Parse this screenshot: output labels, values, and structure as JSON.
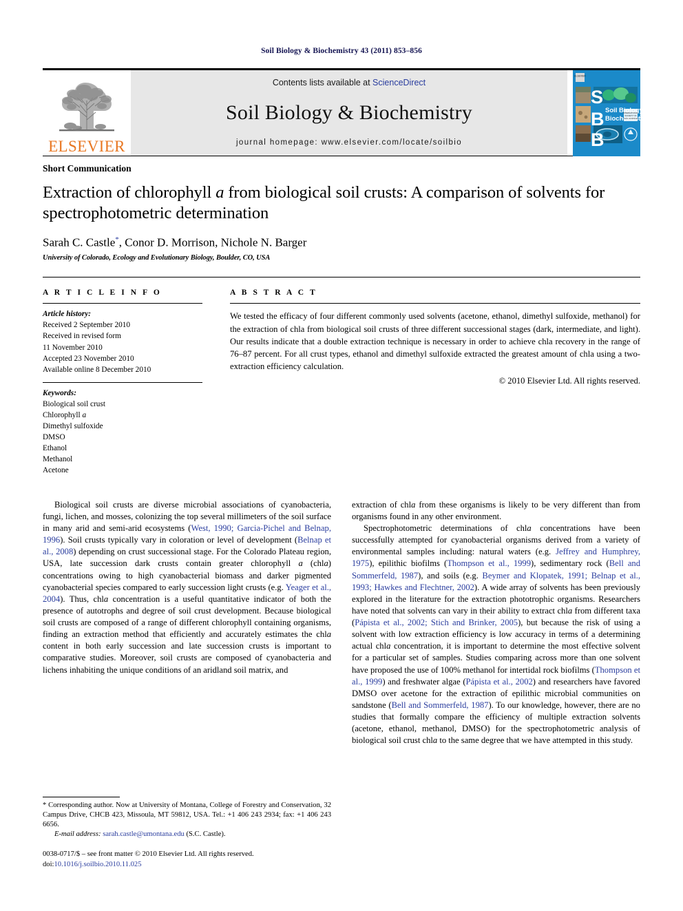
{
  "running_head": "Soil Biology & Biochemistry 43 (2011) 853–856",
  "masthead": {
    "publisher_wordmark": "ELSEVIER",
    "contents_prefix": "Contents lists available at ",
    "contents_link": "ScienceDirect",
    "journal_name": "Soil Biology & Biochemistry",
    "homepage_label": "journal homepage: www.elsevier.com/locate/soilbio",
    "cover": {
      "letters": [
        "S",
        "B",
        "B"
      ],
      "title_line1": "Soil Biology &",
      "title_line2": "Biochemistry",
      "background_color": "#1b8ac9"
    },
    "band_color": "#e7e7e7",
    "wordmark_color": "#E87722",
    "link_color": "#2a3d9e"
  },
  "article": {
    "section_type": "Short Communication",
    "title_part1": "Extraction of chlorophyll ",
    "title_italic": "a",
    "title_part2": " from biological soil crusts: A comparison of solvents for spectrophotometric determination",
    "authors": "Sarah C. Castle",
    "authors_rest": ", Conor D. Morrison, Nichole N. Barger",
    "corresponding_marker": "*",
    "affiliation": "University of Colorado, Ecology and Evolutionary Biology, Boulder, CO, USA"
  },
  "article_info": {
    "heading": "A R T I C L E   I N F O",
    "history_label": "Article history:",
    "history": [
      "Received 2 September 2010",
      "Received in revised form",
      "11 November 2010",
      "Accepted 23 November 2010",
      "Available online 8 December 2010"
    ],
    "keywords_label": "Keywords:",
    "keywords": [
      "Biological soil crust",
      "Chlorophyll a",
      "Dimethyl sulfoxide",
      "DMSO",
      "Ethanol",
      "Methanol",
      "Acetone"
    ]
  },
  "abstract": {
    "heading": "A B S T R A C T",
    "text": "We tested the efficacy of four different commonly used solvents (acetone, ethanol, dimethyl sulfoxide, methanol) for the extraction of chla from biological soil crusts of three different successional stages (dark, intermediate, and light). Our results indicate that a double extraction technique is necessary in order to achieve chla recovery in the range of 76–87 percent. For all crust types, ethanol and dimethyl sulfoxide extracted the greatest amount of chla using a two-extraction efficiency calculation.",
    "copyright": "© 2010 Elsevier Ltd. All rights reserved."
  },
  "body": {
    "left_column_paragraphs": [
      "Biological soil crusts are diverse microbial associations of cyanobacteria, fungi, lichen, and mosses, colonizing the top several millimeters of the soil surface in many arid and semi-arid ecosystems (West, 1990; Garcia-Pichel and Belnap, 1996). Soil crusts typically vary in coloration or level of development (Belnap et al., 2008) depending on crust successional stage. For the Colorado Plateau region, USA, late succession dark crusts contain greater chlorophyll a (chla) concentrations owing to high cyanobacterial biomass and darker pigmented cyanobacterial species compared to early succession light crusts (e.g. Yeager et al., 2004). Thus, chla concentration is a useful quantitative indicator of both the presence of autotrophs and degree of soil crust development. Because biological soil crusts are composed of a range of different chlorophyll containing organisms, finding an extraction method that efficiently and accurately estimates the chla content in both early succession and late succession crusts is important to comparative studies. Moreover, soil crusts are composed of cyanobacteria and lichens inhabiting the unique conditions of an aridland soil matrix, and"
    ],
    "right_column_paragraphs": [
      "extraction of chla from these organisms is likely to be very different than from organisms found in any other environment.",
      "Spectrophotometric determinations of chla concentrations have been successfully attempted for cyanobacterial organisms derived from a variety of environmental samples including: natural waters (e.g. Jeffrey and Humphrey, 1975), epilithic biofilms (Thompson et al., 1999), sedimentary rock (Bell and Sommerfeld, 1987), and soils (e.g. Beymer and Klopatek, 1991; Belnap et al., 1993; Hawkes and Flechtner, 2002). A wide array of solvents has been previously explored in the literature for the extraction phototrophic organisms. Researchers have noted that solvents can vary in their ability to extract chla from different taxa (Pápista et al., 2002; Stich and Brinker, 2005), but because the risk of using a solvent with low extraction efficiency is low accuracy in terms of a determining actual chla concentration, it is important to determine the most effective solvent for a particular set of samples. Studies comparing across more than one solvent have proposed the use of 100% methanol for intertidal rock biofilms (Thompson et al., 1999) and freshwater algae (Pápista et al., 2002) and researchers have favored DMSO over acetone for the extraction of epilithic microbial communities on sandstone (Bell and Sommerfeld, 1987). To our knowledge, however, there are no studies that formally compare the efficiency of multiple extraction solvents (acetone, ethanol, methanol, DMSO) for the spectrophotometric analysis of biological soil crust chla to the same degree that we have attempted in this study."
    ]
  },
  "footnote": {
    "corresponding": "* Corresponding author. Now at University of Montana, College of Forestry and Conservation, 32 Campus Drive, CHCB 423, Missoula, MT 59812, USA. Tel.: +1 406 243 2934; fax: +1 406 243 6656.",
    "email_label": "E-mail address:",
    "email": "sarah.castle@umontana.edu",
    "email_owner": "(S.C. Castle).",
    "issn_line": "0038-0717/$ – see front matter © 2010 Elsevier Ltd. All rights reserved.",
    "doi_label": "doi:",
    "doi": "10.1016/j.soilbio.2010.11.025"
  }
}
